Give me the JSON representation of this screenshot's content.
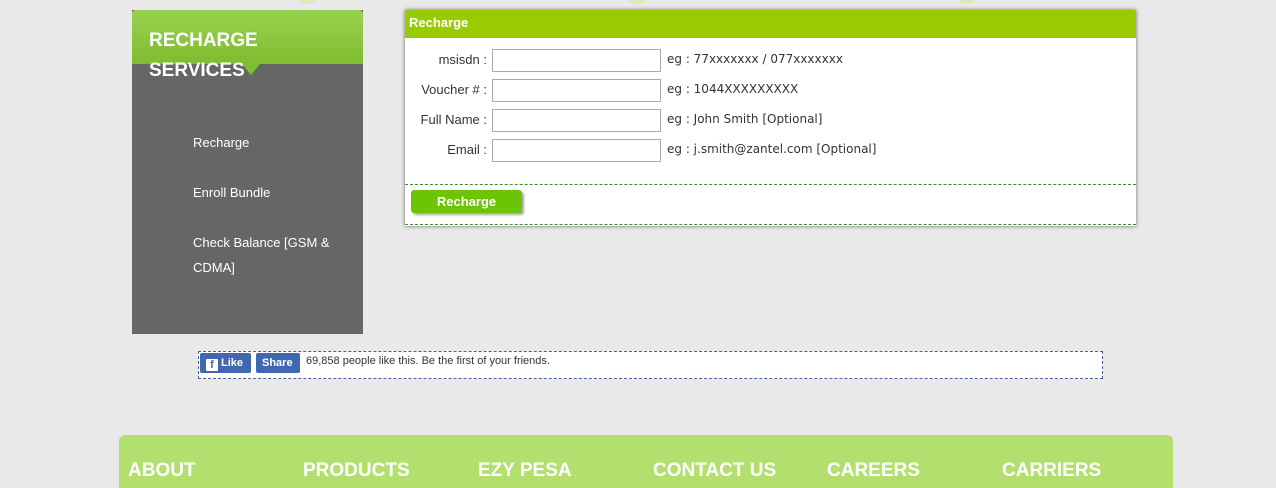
{
  "sidebar": {
    "title_line1": "RECHARGE",
    "title_line2": "SERVICES",
    "items": [
      {
        "label": "Recharge"
      },
      {
        "label": "Enroll Bundle"
      },
      {
        "label": "Check Balance [GSM & CDMA]"
      }
    ]
  },
  "form": {
    "title": "Recharge",
    "fields": [
      {
        "label": "msisdn :",
        "value": "",
        "hint": "eg : 77xxxxxxx / 077xxxxxxx"
      },
      {
        "label": "Voucher # :",
        "value": "",
        "hint": "eg : 1044XXXXXXXXX"
      },
      {
        "label": "Full Name :",
        "value": "",
        "hint": "eg : John Smith [Optional]"
      },
      {
        "label": "Email :",
        "value": "",
        "hint": "eg : j.smith@zantel.com [Optional]"
      }
    ],
    "submit_label": "Recharge"
  },
  "facebook": {
    "like_label": "Like",
    "like_icon": "f",
    "share_label": "Share",
    "social_text": "69,858 people like this. Be the first of your friends."
  },
  "footer": {
    "items": [
      "ABOUT",
      "PRODUCTS",
      "EZY PESA",
      "CONTACT US",
      "CAREERS",
      "CARRIERS"
    ]
  },
  "colors": {
    "accent_green": "#99cc00",
    "button_green": "#6cc404",
    "sidebar_bg": "#666666",
    "footer_bg": "#b3df6e",
    "facebook_blue": "#4267b2"
  }
}
